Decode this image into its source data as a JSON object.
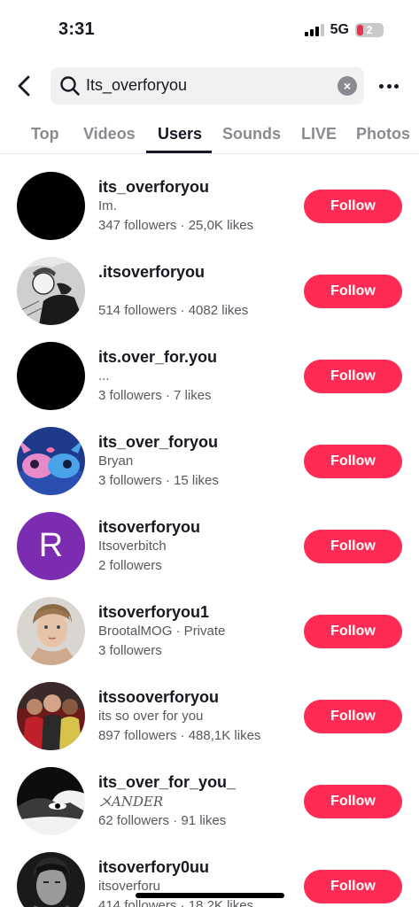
{
  "status_bar": {
    "time": "3:31",
    "network": "5G",
    "battery": "2"
  },
  "search": {
    "query": "Its_overforyou",
    "clear_label": "×"
  },
  "tabs": [
    {
      "label": "Top",
      "active": false
    },
    {
      "label": "Videos",
      "active": false
    },
    {
      "label": "Users",
      "active": true
    },
    {
      "label": "Sounds",
      "active": false
    },
    {
      "label": "LIVE",
      "active": false
    },
    {
      "label": "Photos",
      "active": false
    }
  ],
  "users": [
    {
      "username": "its_overforyou",
      "subtitle": "Im.",
      "stats": "347 followers · 25,0K likes",
      "follow_label": "Follow"
    },
    {
      "username": ".itsoverforyou",
      "subtitle": "",
      "stats": "514 followers · 4082 likes",
      "follow_label": "Follow"
    },
    {
      "username": "its.over_for.you",
      "subtitle": "...",
      "stats": "3 followers · 7 likes",
      "follow_label": "Follow"
    },
    {
      "username": "its_over_foryou",
      "subtitle": "Bryan",
      "stats": "3 followers · 15 likes",
      "follow_label": "Follow"
    },
    {
      "username": "itsoverforyou",
      "subtitle": "Itsoverbitch",
      "stats": "2 followers",
      "follow_label": "Follow",
      "avatar_letter": "R"
    },
    {
      "username": "itsoverforyou1",
      "subtitle": "BrootalMOG · Private",
      "stats": "3 followers",
      "follow_label": "Follow"
    },
    {
      "username": "itssooverforyou",
      "subtitle": "its so over for you",
      "stats": "897 followers · 488,1K likes",
      "follow_label": "Follow"
    },
    {
      "username": "its_over_for_you_",
      "subtitle": "メANDER",
      "stats": "62 followers · 91 likes",
      "follow_label": "Follow"
    },
    {
      "username": "itsoverfory0uu",
      "subtitle": "itsoverforu",
      "stats": "414 followers · 18,2K likes",
      "follow_label": "Follow"
    }
  ],
  "colors": {
    "accent": "#fe2c55",
    "text": "#161823",
    "muted": "#8a8b91",
    "purple_avatar": "#7b2cb0"
  }
}
